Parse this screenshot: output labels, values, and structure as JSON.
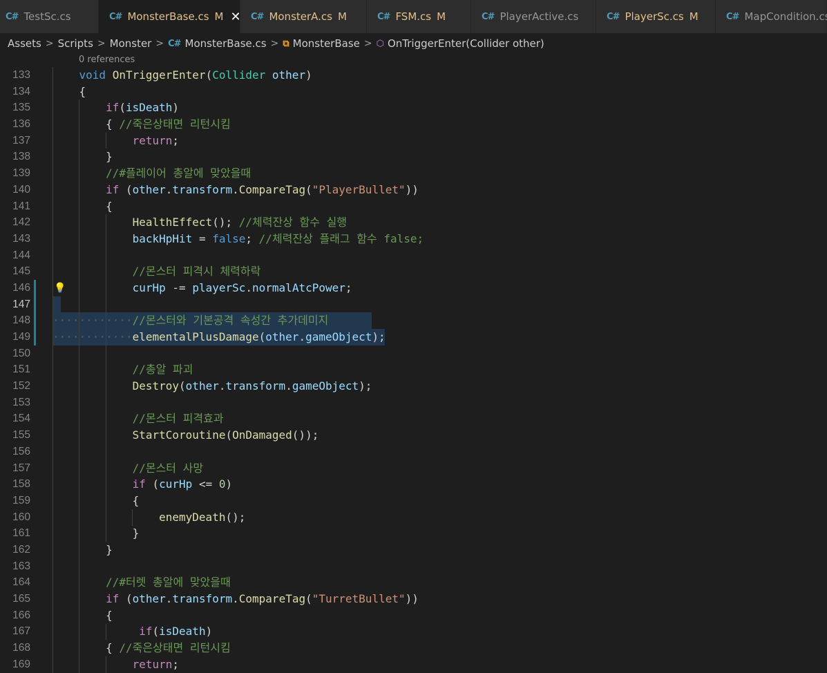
{
  "tabs": [
    {
      "label": "TestSc.cs",
      "flag": "",
      "active": false,
      "modified": false
    },
    {
      "label": "MonsterBase.cs",
      "flag": "M",
      "active": true,
      "modified": true
    },
    {
      "label": "MonsterA.cs",
      "flag": "M",
      "active": false,
      "modified": true
    },
    {
      "label": "FSM.cs",
      "flag": "M",
      "active": false,
      "modified": true
    },
    {
      "label": "PlayerActive.cs",
      "flag": "",
      "active": false,
      "modified": false
    },
    {
      "label": "PlayerSc.cs",
      "flag": "M",
      "active": false,
      "modified": true
    },
    {
      "label": "MapCondition.cs",
      "flag": "",
      "active": false,
      "modified": false
    }
  ],
  "tab_close_glyph": "✕",
  "breadcrumb": {
    "items": [
      "Assets",
      "Scripts",
      "Monster",
      "MonsterBase.cs",
      "MonsterBase",
      "OnTriggerEnter(Collider other)"
    ]
  },
  "editor": {
    "references": "0 references",
    "current_line": 147,
    "lines": [
      {
        "n": 133,
        "code": "    void OnTriggerEnter(Collider other)"
      },
      {
        "n": 134,
        "code": "    {"
      },
      {
        "n": 135,
        "code": "        if(isDeath)"
      },
      {
        "n": 136,
        "code": "        { //죽은상태면 리턴시킴"
      },
      {
        "n": 137,
        "code": "            return;"
      },
      {
        "n": 138,
        "code": "        }"
      },
      {
        "n": 139,
        "code": "        //#플레이어 총알에 맞았을때"
      },
      {
        "n": 140,
        "code": "        if (other.transform.CompareTag(\"PlayerBullet\"))"
      },
      {
        "n": 141,
        "code": "        {"
      },
      {
        "n": 142,
        "code": "            HealthEffect(); //체력잔상 함수 실행"
      },
      {
        "n": 143,
        "code": "            backHpHit = false; //체력잔상 플래그 함수 false;"
      },
      {
        "n": 144,
        "code": ""
      },
      {
        "n": 145,
        "code": "            //몬스터 피격시 체력하락"
      },
      {
        "n": 146,
        "code": "            curHp -= playerSc.normalAtcPower;"
      },
      {
        "n": 147,
        "code": ""
      },
      {
        "n": 148,
        "code": "            //몬스터와 기본공격 속성간 추가데미지"
      },
      {
        "n": 149,
        "code": "            elementalPlusDamage(other.gameObject);"
      },
      {
        "n": 150,
        "code": ""
      },
      {
        "n": 151,
        "code": "            //총알 파괴"
      },
      {
        "n": 152,
        "code": "            Destroy(other.transform.gameObject);"
      },
      {
        "n": 153,
        "code": ""
      },
      {
        "n": 154,
        "code": "            //몬스터 피격효과"
      },
      {
        "n": 155,
        "code": "            StartCoroutine(OnDamaged());"
      },
      {
        "n": 156,
        "code": ""
      },
      {
        "n": 157,
        "code": "            //몬스터 사망"
      },
      {
        "n": 158,
        "code": "            if (curHp <= 0)"
      },
      {
        "n": 159,
        "code": "            {"
      },
      {
        "n": 160,
        "code": "                enemyDeath();"
      },
      {
        "n": 161,
        "code": "            }"
      },
      {
        "n": 162,
        "code": "        }"
      },
      {
        "n": 163,
        "code": ""
      },
      {
        "n": 164,
        "code": "        //#터렛 총알에 맞았을때"
      },
      {
        "n": 165,
        "code": "        if (other.transform.CompareTag(\"TurretBullet\"))"
      },
      {
        "n": 166,
        "code": "        {"
      },
      {
        "n": 167,
        "code": "             if(isDeath)"
      },
      {
        "n": 168,
        "code": "        { //죽은상태면 리턴시킴"
      },
      {
        "n": 169,
        "code": "            return;"
      }
    ]
  },
  "colors": {
    "background": "#1e1e1e",
    "keyword": "#569cd6",
    "control": "#c586c0",
    "function": "#dcdcaa",
    "variable": "#9cdcfe",
    "type": "#4ec9b0",
    "string": "#ce9178",
    "comment": "#6a9955",
    "selection": "#264f78",
    "modified_tab": "#e2c08d"
  }
}
